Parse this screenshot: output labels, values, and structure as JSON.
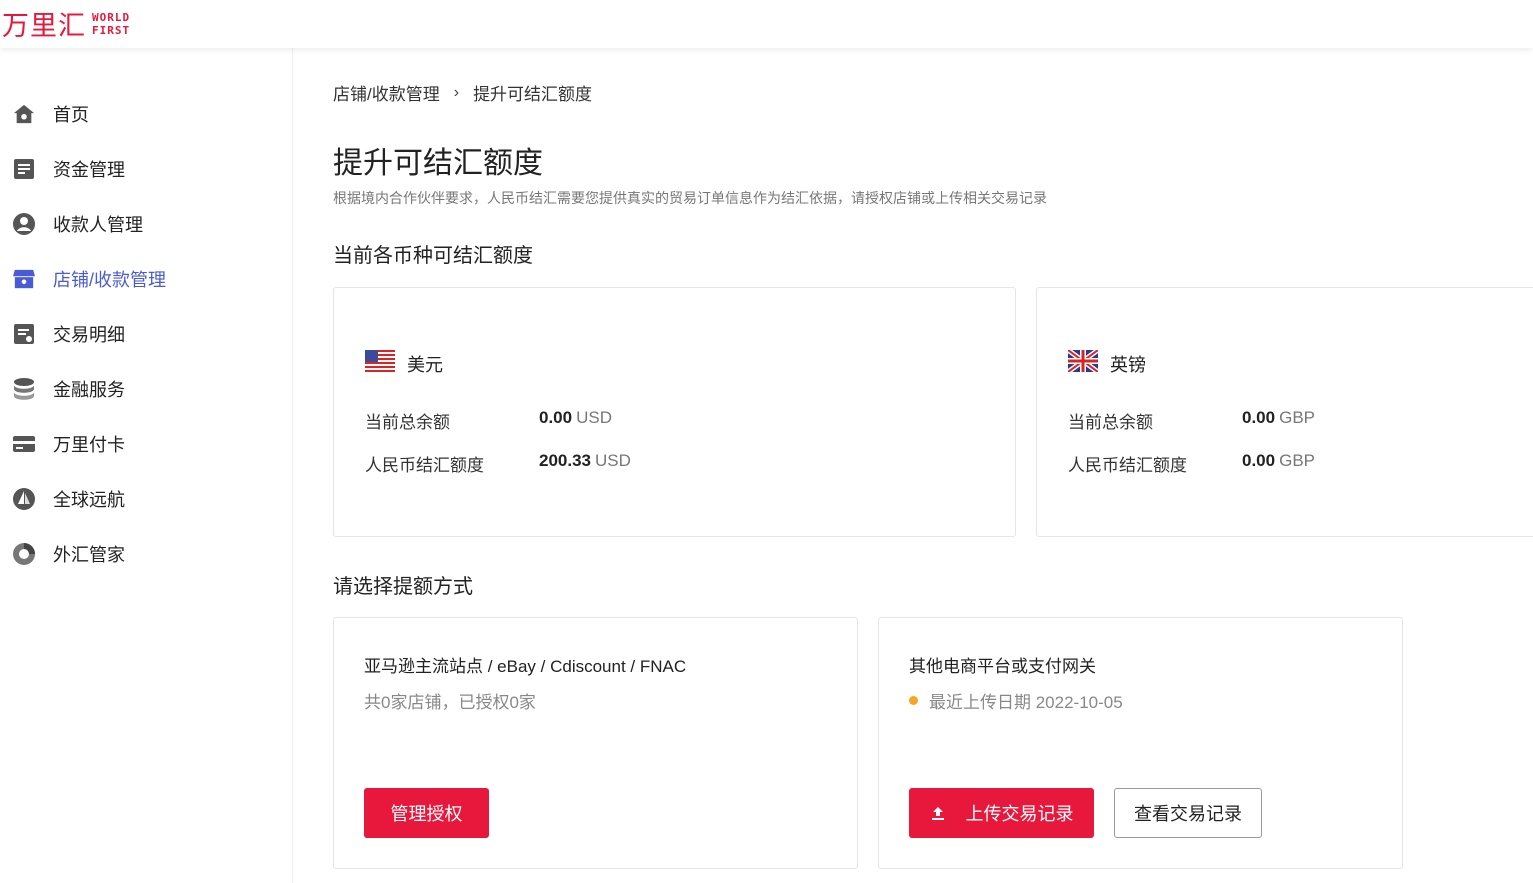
{
  "brand": {
    "cn": "万里汇",
    "en_line1": "WORLD",
    "en_line2": "FIRST",
    "color": "#e8183c"
  },
  "sidebar": {
    "items": [
      {
        "label": "首页",
        "icon": "home-icon"
      },
      {
        "label": "资金管理",
        "icon": "document-icon"
      },
      {
        "label": "收款人管理",
        "icon": "user-icon"
      },
      {
        "label": "店铺/收款管理",
        "icon": "store-icon",
        "active": true
      },
      {
        "label": "交易明细",
        "icon": "list-icon"
      },
      {
        "label": "金融服务",
        "icon": "database-icon"
      },
      {
        "label": "万里付卡",
        "icon": "card-icon"
      },
      {
        "label": "全球远航",
        "icon": "sailboat-icon"
      },
      {
        "label": "外汇管家",
        "icon": "exchange-icon"
      }
    ]
  },
  "breadcrumb": {
    "parent": "店铺/收款管理",
    "separator": "›",
    "current": "提升可结汇额度"
  },
  "page": {
    "title": "提升可结汇额度",
    "description": "根据境内合作伙伴要求，人民币结汇需要您提供真实的贸易订单信息作为结汇依据，请授权店铺或上传相关交易记录"
  },
  "quota_section": {
    "title": "当前各币种可结汇额度",
    "currencies": [
      {
        "name": "美元",
        "flag": "us-flag-icon",
        "total_label": "当前总余额",
        "total_value": "0.00",
        "total_unit": "USD",
        "rmb_label": "人民币结汇额度",
        "rmb_value": "200.33",
        "rmb_unit": "USD"
      },
      {
        "name": "英镑",
        "flag": "uk-flag-icon",
        "total_label": "当前总余额",
        "total_value": "0.00",
        "total_unit": "GBP",
        "rmb_label": "人民币结汇额度",
        "rmb_value": "0.00",
        "rmb_unit": "GBP"
      }
    ]
  },
  "method_section": {
    "title": "请选择提额方式",
    "amazon": {
      "title": "亚马逊主流站点 / eBay / Cdiscount / FNAC",
      "subtitle": "共0家店铺，已授权0家",
      "button": "管理授权"
    },
    "other": {
      "title": "其他电商平台或支付网关",
      "status": "最近上传日期 2022-10-05",
      "upload_button": "上传交易记录",
      "view_button": "查看交易记录"
    }
  },
  "colors": {
    "accent": "#e8183c",
    "active_nav": "#4a5bd4",
    "status_dot": "#f5a623"
  }
}
